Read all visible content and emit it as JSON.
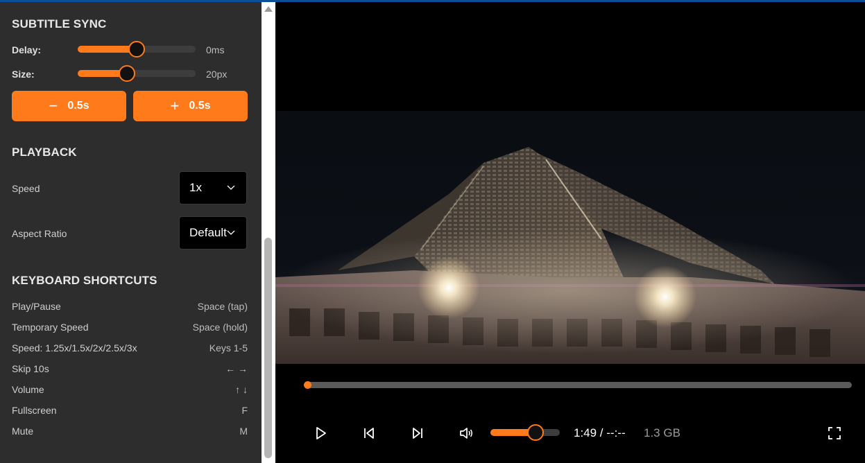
{
  "subtitle_sync": {
    "title": "SUBTITLE SYNC",
    "delay": {
      "label": "Delay:",
      "value_text": "0ms",
      "fraction": 0.5
    },
    "size": {
      "label": "Size:",
      "value_text": "20px",
      "fraction": 0.42
    },
    "minus_button": {
      "symbol": "−",
      "label": "0.5s"
    },
    "plus_button": {
      "symbol": "+",
      "label": "0.5s"
    }
  },
  "playback": {
    "title": "PLAYBACK",
    "speed": {
      "label": "Speed",
      "value": "1x"
    },
    "aspect_ratio": {
      "label": "Aspect Ratio",
      "value": "Default"
    }
  },
  "shortcuts": {
    "title": "KEYBOARD SHORTCUTS",
    "items": [
      {
        "action": "Play/Pause",
        "key": "Space (tap)"
      },
      {
        "action": "Temporary Speed",
        "key": "Space (hold)"
      },
      {
        "action": "Speed: 1.25x/1.5x/2x/2.5x/3x",
        "key": "Keys 1-5"
      },
      {
        "action": "Skip 10s",
        "key": "← →"
      },
      {
        "action": "Volume",
        "key": "↑ ↓"
      },
      {
        "action": "Fullscreen",
        "key": "F"
      },
      {
        "action": "Mute",
        "key": "M"
      }
    ]
  },
  "player": {
    "progress_fraction": 0.0,
    "volume_fraction": 0.65,
    "time": "1:49 / --:--",
    "file_size": "1.3 GB",
    "icons": [
      "play-icon",
      "skip-back-icon",
      "skip-forward-icon",
      "volume-icon",
      "fullscreen-icon"
    ]
  },
  "colors": {
    "accent": "#ff7a1a",
    "sidebar_bg": "#2d2d2d",
    "topbar": "#0b4f9c"
  }
}
